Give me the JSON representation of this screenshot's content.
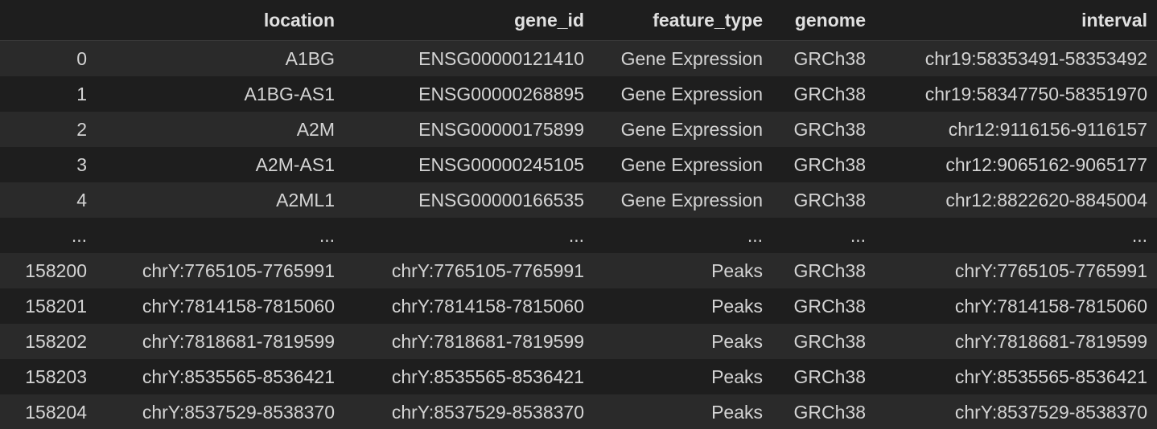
{
  "table": {
    "columns": [
      "",
      "location",
      "gene_id",
      "feature_type",
      "genome",
      "interval"
    ],
    "rows": [
      {
        "index": "0",
        "location": "A1BG",
        "gene_id": "ENSG00000121410",
        "feature_type": "Gene Expression",
        "genome": "GRCh38",
        "interval": "chr19:58353491-58353492"
      },
      {
        "index": "1",
        "location": "A1BG-AS1",
        "gene_id": "ENSG00000268895",
        "feature_type": "Gene Expression",
        "genome": "GRCh38",
        "interval": "chr19:58347750-58351970"
      },
      {
        "index": "2",
        "location": "A2M",
        "gene_id": "ENSG00000175899",
        "feature_type": "Gene Expression",
        "genome": "GRCh38",
        "interval": "chr12:9116156-9116157"
      },
      {
        "index": "3",
        "location": "A2M-AS1",
        "gene_id": "ENSG00000245105",
        "feature_type": "Gene Expression",
        "genome": "GRCh38",
        "interval": "chr12:9065162-9065177"
      },
      {
        "index": "4",
        "location": "A2ML1",
        "gene_id": "ENSG00000166535",
        "feature_type": "Gene Expression",
        "genome": "GRCh38",
        "interval": "chr12:8822620-8845004"
      },
      {
        "index": "...",
        "location": "...",
        "gene_id": "...",
        "feature_type": "...",
        "genome": "...",
        "interval": "..."
      },
      {
        "index": "158200",
        "location": "chrY:7765105-7765991",
        "gene_id": "chrY:7765105-7765991",
        "feature_type": "Peaks",
        "genome": "GRCh38",
        "interval": "chrY:7765105-7765991"
      },
      {
        "index": "158201",
        "location": "chrY:7814158-7815060",
        "gene_id": "chrY:7814158-7815060",
        "feature_type": "Peaks",
        "genome": "GRCh38",
        "interval": "chrY:7814158-7815060"
      },
      {
        "index": "158202",
        "location": "chrY:7818681-7819599",
        "gene_id": "chrY:7818681-7819599",
        "feature_type": "Peaks",
        "genome": "GRCh38",
        "interval": "chrY:7818681-7819599"
      },
      {
        "index": "158203",
        "location": "chrY:8535565-8536421",
        "gene_id": "chrY:8535565-8536421",
        "feature_type": "Peaks",
        "genome": "GRCh38",
        "interval": "chrY:8535565-8536421"
      },
      {
        "index": "158204",
        "location": "chrY:8537529-8538370",
        "gene_id": "chrY:8537529-8538370",
        "feature_type": "Peaks",
        "genome": "GRCh38",
        "interval": "chrY:8537529-8538370"
      }
    ]
  }
}
